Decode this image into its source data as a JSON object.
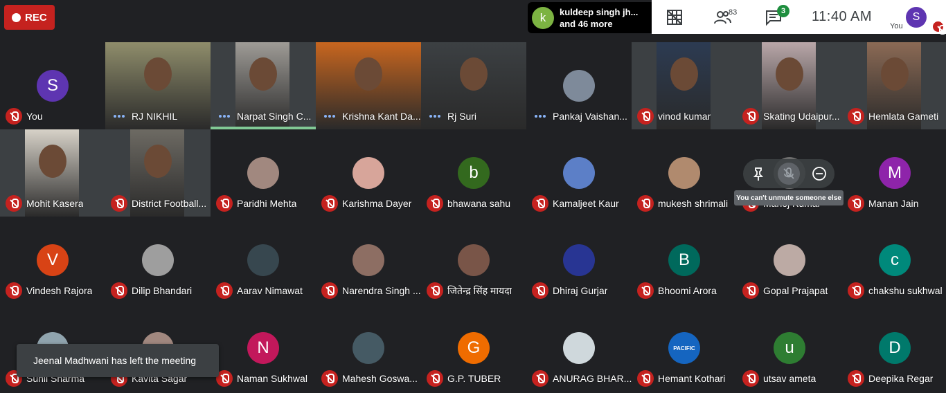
{
  "rec_label": "REC",
  "join_notice": {
    "avatar_letter": "k",
    "line1": "kuldeep singh jh...",
    "line2": "and 46 more"
  },
  "toolbar": {
    "participants_count": "83",
    "chat_unread": "3",
    "time": "11:40  AM",
    "self_label": "You",
    "self_letter": "S"
  },
  "colors": {
    "rec": "#c5221f",
    "muted": "#c5221f",
    "speaking": "#81c995",
    "bg": "#202124",
    "tile": "#3c4043"
  },
  "tiles": [
    {
      "name": "You",
      "letter": "S",
      "avatar_color": "#5e35b1",
      "state": "muted"
    },
    {
      "name": "RJ NIKHIL",
      "video": true,
      "state": "speaking"
    },
    {
      "name": "Narpat Singh C...",
      "video": true,
      "state": "speaking",
      "active": true
    },
    {
      "name": "Krishna Kant Da...",
      "video": true,
      "state": "speaking"
    },
    {
      "name": "Rj Suri",
      "video": true,
      "state": "speaking"
    },
    {
      "name": "Pankaj Vaishan...",
      "photo_avatar": true,
      "avatar_color": "#7e8a9a",
      "state": "speaking"
    },
    {
      "name": "vinod kumar",
      "video": true,
      "state": "muted"
    },
    {
      "name": "Skating Udaipur...",
      "video": true,
      "state": "muted"
    },
    {
      "name": "Hemlata Gameti",
      "video": true,
      "state": "muted"
    },
    {
      "name": "Mohit Kasera",
      "video": true,
      "state": "muted"
    },
    {
      "name": "District Football...",
      "video": true,
      "state": "muted"
    },
    {
      "name": "Paridhi Mehta",
      "photo_avatar": true,
      "avatar_color": "#a1887f",
      "state": "muted"
    },
    {
      "name": "Karishma Dayer",
      "photo_avatar": true,
      "avatar_color": "#d7a59a",
      "state": "muted"
    },
    {
      "name": "bhawana sahu",
      "letter": "b",
      "avatar_color": "#33691e",
      "state": "muted"
    },
    {
      "name": "Kamaljeet Kaur",
      "photo_avatar": true,
      "avatar_color": "#5c7fc7",
      "state": "muted"
    },
    {
      "name": "mukesh shrimali",
      "photo_avatar": true,
      "avatar_color": "#b08a6e",
      "state": "muted"
    },
    {
      "name": "Manoj Kumar",
      "photo_avatar": true,
      "avatar_color": "#6d6d6d",
      "state": "muted"
    },
    {
      "name": "Manan Jain",
      "letter": "M",
      "avatar_color": "#8e24aa",
      "state": "muted"
    },
    {
      "name": "Vindesh Rajora",
      "letter": "V",
      "avatar_color": "#d84315",
      "state": "muted"
    },
    {
      "name": "Dilip Bhandari",
      "photo_avatar": true,
      "avatar_color": "#9e9e9e",
      "state": "muted"
    },
    {
      "name": "Aarav Nimawat",
      "photo_avatar": true,
      "avatar_color": "#37474f",
      "state": "muted"
    },
    {
      "name": "Narendra Singh ...",
      "photo_avatar": true,
      "avatar_color": "#8d6e63",
      "state": "muted"
    },
    {
      "name": "जितेन्द्र सिंह मायदा",
      "photo_avatar": true,
      "avatar_color": "#795548",
      "state": "muted"
    },
    {
      "name": "Dhiraj Gurjar",
      "photo_avatar": true,
      "avatar_color": "#283593",
      "state": "muted"
    },
    {
      "name": "Bhoomi Arora",
      "letter": "B",
      "avatar_color": "#00695c",
      "state": "muted"
    },
    {
      "name": "Gopal Prajapat",
      "photo_avatar": true,
      "avatar_color": "#bcaaa4",
      "state": "muted"
    },
    {
      "name": "chakshu sukhwal",
      "letter": "c",
      "avatar_color": "#00897b",
      "state": "muted"
    },
    {
      "name": "Sunil Sharma",
      "photo_avatar": true,
      "avatar_color": "#90a4ae",
      "state": "muted"
    },
    {
      "name": "Kavita Sagar",
      "photo_avatar": true,
      "avatar_color": "#a1887f",
      "state": "muted"
    },
    {
      "name": "Naman Sukhwal",
      "letter": "N",
      "avatar_color": "#c2185b",
      "state": "muted"
    },
    {
      "name": "Mahesh Goswa...",
      "photo_avatar": true,
      "avatar_color": "#455a64",
      "state": "muted"
    },
    {
      "name": "G.P. TUBER",
      "letter": "G",
      "avatar_color": "#ef6c00",
      "state": "muted"
    },
    {
      "name": "ANURAG BHAR...",
      "photo_avatar": true,
      "avatar_color": "#cfd8dc",
      "state": "muted"
    },
    {
      "name": "Hemant Kothari",
      "photo_avatar": true,
      "avatar_color": "#1565c0",
      "logo_text": "PACIFIC",
      "state": "muted"
    },
    {
      "name": "utsav ameta",
      "letter": "u",
      "avatar_color": "#2e7d32",
      "state": "muted"
    },
    {
      "name": "Deepika Regar",
      "letter": "D",
      "avatar_color": "#00796b",
      "state": "muted"
    }
  ],
  "tooltip": "You can't unmute someone else",
  "toast": "Jeenal Madhwani has left the meeting"
}
